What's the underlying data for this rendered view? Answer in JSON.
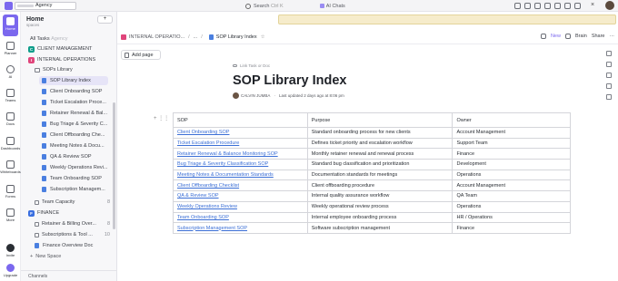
{
  "topbar": {
    "workspace_name": "Agency",
    "search_label": "Search",
    "search_shortcut": "Ctrl K",
    "ai_label": "AI Chats"
  },
  "rail": {
    "items": [
      {
        "label": "Home",
        "icon": "home-icon"
      },
      {
        "label": "Planner",
        "icon": "planner-icon"
      },
      {
        "label": "AI",
        "icon": "ai-icon"
      },
      {
        "label": "Teams",
        "icon": "teams-icon"
      },
      {
        "label": "Docs",
        "icon": "docs-icon"
      },
      {
        "label": "Dashboards",
        "icon": "dashboards-icon"
      },
      {
        "label": "Whiteboards",
        "icon": "whiteboards-icon"
      },
      {
        "label": "Forms",
        "icon": "forms-icon"
      },
      {
        "label": "More",
        "icon": "more-icon"
      },
      {
        "label": "Invite",
        "icon": "invite-icon"
      },
      {
        "label": "Upgrade",
        "icon": "upgrade-icon"
      }
    ]
  },
  "sidebar": {
    "title": "Home",
    "subtitle": "spaces",
    "add_label": "+",
    "all_tasks": "All Tasks",
    "all_tasks_suffix": "Agency",
    "client_management": "CLIENT MANAGEMENT",
    "client_management_initial": "C",
    "internal_operations": "INTERNAL OPERATIONS",
    "internal_operations_initial": "I",
    "sops_folder": "SOPs Library",
    "docs": [
      "SOP Library Index",
      "Client Onboarding SOP",
      "Ticket Escalation Proce...",
      "Retainer Renewal & Bal...",
      "Bug Triage & Severity C...",
      "Client Offboarding Che...",
      "Meeting Notes & Docu...",
      "QA & Review SOP",
      "Weekly Operations Revi...",
      "Team Onboarding SOP",
      "Subscription Managem..."
    ],
    "team_capacity": "Team Capacity",
    "team_capacity_count": "8",
    "finance": "FINANCE",
    "finance_initial": "F",
    "retainer_billing": "Retainer & Billing Over...",
    "retainer_billing_count": "8",
    "subscriptions": "Subscriptions & Tool ...",
    "subscriptions_count": "10",
    "finance_overview": "Finance Overview Doc",
    "new_space": "New Space",
    "channels": "Channels"
  },
  "breadcrumbs": {
    "space": "INTERNAL OPERATIO...",
    "ellipsis": "...",
    "current": "SOP Library Index",
    "new_label": "New",
    "brain_label": "Brain",
    "share_label": "Share"
  },
  "doc": {
    "add_page": "Add page",
    "link_task": "Link Task or Doc",
    "title": "SOP Library Index",
    "author": "CALVIN JUMBA",
    "updated": "Last updated 2 days ago at 8:06 pm"
  },
  "table": {
    "headers": [
      "SOP",
      "Purpose",
      "Owner"
    ],
    "rows": [
      [
        "Client Onboarding SOP",
        "Standard onboarding process for new clients",
        "Account Management"
      ],
      [
        "Ticket Escalation Procedure",
        "Defines ticket priority and escalation workflow",
        "Support Team"
      ],
      [
        "Retainer Renewal & Balance Monitoring SOP",
        "Monthly retainer renewal and renewal process",
        "Finance"
      ],
      [
        "Bug Triage & Severity Classification SOP",
        "Standard bug classification and prioritization",
        "Development"
      ],
      [
        "Meeting Notes & Documentation Standards",
        "Documentation standards for meetings",
        "Operations"
      ],
      [
        "Client Offboarding Checklist",
        "Client offboarding procedure",
        "Account Management"
      ],
      [
        "QA & Review SOP",
        "Internal quality assurance workflow",
        "QA Team"
      ],
      [
        "Weekly Operations Review",
        "Weekly operational review process",
        "Operations"
      ],
      [
        "Team Onboarding SOP",
        "Internal employee onboarding process",
        "HR / Operations"
      ],
      [
        "Subscription Management SOP",
        "Software subscription management",
        "Finance"
      ]
    ]
  },
  "colors": {
    "accent": "#7b68ee",
    "link": "#3b6fd6",
    "client_space": "#0f9d8a",
    "internal_space": "#e0457b",
    "finance_space": "#3a6fe0"
  }
}
